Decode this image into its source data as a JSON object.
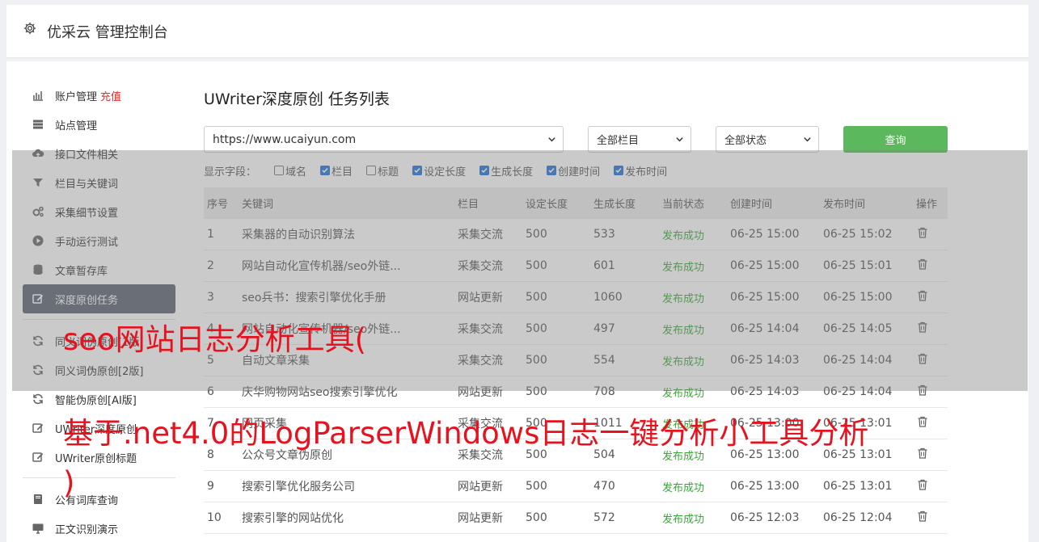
{
  "header": {
    "title": "优采云 管理控制台",
    "icon": "gear-icon"
  },
  "sidebar": {
    "items": [
      {
        "label": "账户管理",
        "extra": "充值",
        "icon": "bar-chart-icon"
      },
      {
        "label": "站点管理",
        "icon": "server-icon"
      },
      {
        "label": "接口文件相关",
        "icon": "cloud-upload-icon"
      },
      {
        "label": "栏目与关键词",
        "icon": "filter-icon"
      },
      {
        "label": "采集细节设置",
        "icon": "gears-icon"
      },
      {
        "label": "手动运行测试",
        "icon": "play-icon"
      },
      {
        "label": "文章暂存库",
        "icon": "database-icon"
      },
      {
        "label": "深度原创任务",
        "icon": "edit-icon",
        "active": true
      },
      {
        "label": "同义词伪原创[1版]",
        "icon": "refresh-icon"
      },
      {
        "label": "同义词伪原创[2版]",
        "icon": "refresh-icon"
      },
      {
        "label": "智能伪原创[AI版]",
        "icon": "refresh-icon"
      },
      {
        "label": "UWriter深度原创",
        "icon": "edit-icon"
      },
      {
        "label": "UWriter原创标题",
        "icon": "edit-icon"
      },
      {
        "label": "公有词库查询",
        "icon": "book-icon"
      },
      {
        "label": "正文识别演示",
        "icon": "monitor-icon"
      }
    ]
  },
  "main": {
    "title": "UWriter深度原创 任务列表",
    "filters": {
      "site": "https://www.ucaiyun.com",
      "column": "全部栏目",
      "status": "全部状态",
      "query_label": "查询"
    },
    "display_fields": {
      "label": "显示字段：",
      "options": [
        {
          "label": "域名",
          "checked": false
        },
        {
          "label": "栏目",
          "checked": true
        },
        {
          "label": "标题",
          "checked": false
        },
        {
          "label": "设定长度",
          "checked": true
        },
        {
          "label": "生成长度",
          "checked": true
        },
        {
          "label": "创建时间",
          "checked": true
        },
        {
          "label": "发布时间",
          "checked": true
        }
      ]
    },
    "table": {
      "headers": [
        "序号",
        "关键词",
        "栏目",
        "设定长度",
        "生成长度",
        "当前状态",
        "创建时间",
        "发布时间",
        "操作"
      ],
      "rows": [
        [
          "1",
          "采集器的自动识别算法",
          "采集交流",
          "500",
          "533",
          "发布成功",
          "06-25 15:00",
          "06-25 15:02"
        ],
        [
          "2",
          "网站自动化宣传机器/seo外链...",
          "采集交流",
          "500",
          "601",
          "发布成功",
          "06-25 15:00",
          "06-25 15:01"
        ],
        [
          "3",
          "seo兵书：搜索引擎优化手册",
          "网站更新",
          "500",
          "1060",
          "发布成功",
          "06-25 15:00",
          "06-25 15:00"
        ],
        [
          "4",
          "网站自动化宣传机器/seo外链...",
          "采集交流",
          "500",
          "497",
          "发布成功",
          "06-25 14:04",
          "06-25 14:05"
        ],
        [
          "5",
          "自动文章采集",
          "采集交流",
          "500",
          "554",
          "发布成功",
          "06-25 14:03",
          "06-25 14:04"
        ],
        [
          "6",
          "庆华购物网站seo搜索引擎优化",
          "网站更新",
          "500",
          "708",
          "发布成功",
          "06-25 14:03",
          "06-25 14:04"
        ],
        [
          "7",
          "网页采集",
          "采集交流",
          "500",
          "1011",
          "发布成功",
          "06-25 13:00",
          "06-25 13:01"
        ],
        [
          "8",
          "公众号文章伪原创",
          "采集交流",
          "500",
          "504",
          "发布成功",
          "06-25 13:00",
          "06-25 13:01"
        ],
        [
          "9",
          "搜索引擎优化服务公司",
          "网站更新",
          "500",
          "470",
          "发布成功",
          "06-25 13:00",
          "06-25 13:01"
        ],
        [
          "10",
          "搜索引擎的网站优化",
          "网站更新",
          "500",
          "572",
          "发布成功",
          "06-25 12:03",
          "06-25 12:04"
        ]
      ]
    }
  },
  "overlay": {
    "line1": "seo网站日志分析工具(",
    "line2": "基于.net4.0的LogParserWindows日志一键分析小工具分析",
    "line3": ")"
  },
  "colors": {
    "accent_green": "#5cb85c",
    "success_text": "#3aa63a",
    "overlay_red": "#e8121e",
    "active_sidebar": "#5a6270"
  }
}
